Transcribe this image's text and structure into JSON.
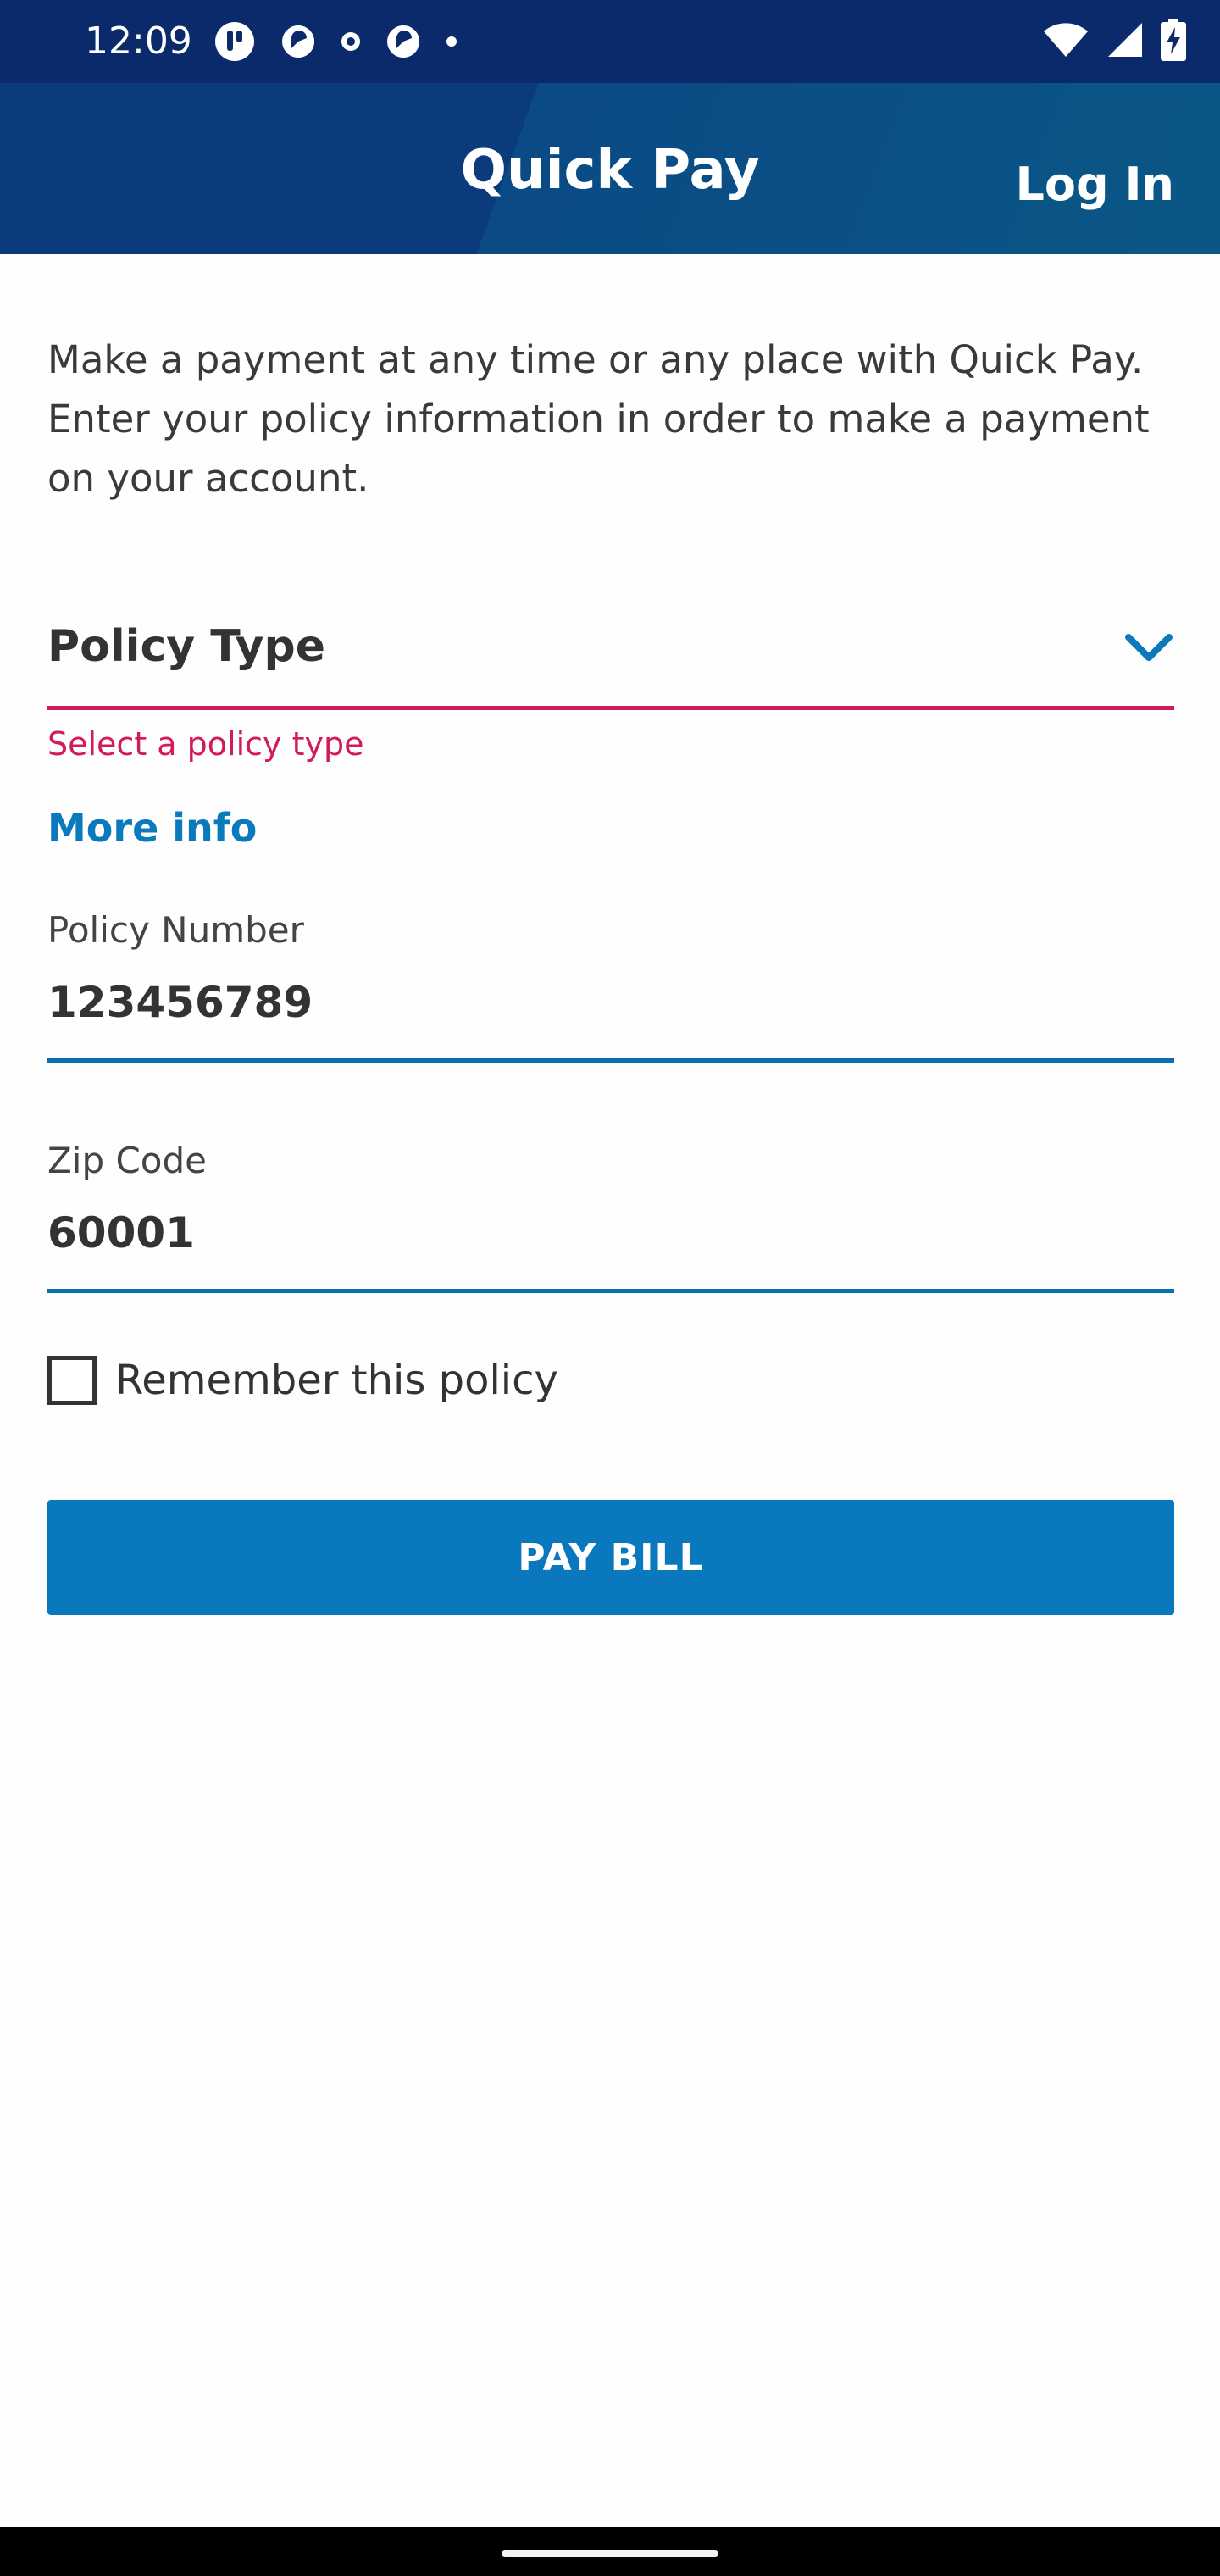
{
  "status_bar": {
    "time": "12:09",
    "left_icons": [
      "notification-app-icon",
      "notification-app-icon",
      "notification-small-icon",
      "notification-app-icon",
      "notification-dot-icon"
    ],
    "right_icons": [
      "wifi-icon",
      "cell-signal-icon",
      "battery-charging-icon"
    ]
  },
  "app_bar": {
    "title": "Quick Pay",
    "login_label": "Log In",
    "colors": {
      "primary": "#0b3a7d",
      "secondary": "#0a5786"
    }
  },
  "intro": {
    "text": "Make a payment at any time or any place with Quick Pay. Enter your policy information in order to make a payment on your account."
  },
  "policy_type": {
    "label": "Policy Type",
    "error": "Select a policy type",
    "error_color": "#d31a5b",
    "icon": "chevron-down-icon"
  },
  "more_info": {
    "label": "More info"
  },
  "policy_number": {
    "label": "Policy Number",
    "value": "123456789"
  },
  "zip_code": {
    "label": "Zip Code",
    "value": "60001"
  },
  "remember": {
    "label": "Remember this policy",
    "checked": false
  },
  "pay_button": {
    "label": "PAY BILL",
    "color": "#0a78bd"
  }
}
